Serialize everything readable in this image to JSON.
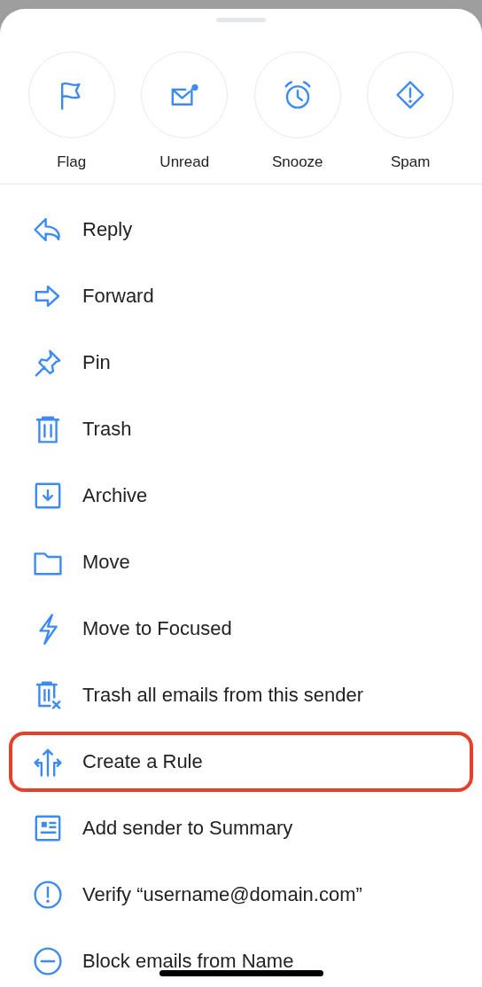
{
  "quick_actions": [
    {
      "label": "Flag",
      "kind": "flag"
    },
    {
      "label": "Unread",
      "kind": "unread"
    },
    {
      "label": "Snooze",
      "kind": "snooze"
    },
    {
      "label": "Spam",
      "kind": "spam"
    }
  ],
  "menu_items": [
    {
      "label": "Reply",
      "kind": "reply",
      "highlighted": false
    },
    {
      "label": "Forward",
      "kind": "forward",
      "highlighted": false
    },
    {
      "label": "Pin",
      "kind": "pin",
      "highlighted": false
    },
    {
      "label": "Trash",
      "kind": "trash",
      "highlighted": false
    },
    {
      "label": "Archive",
      "kind": "archive",
      "highlighted": false
    },
    {
      "label": "Move",
      "kind": "folder",
      "highlighted": false
    },
    {
      "label": "Move to Focused",
      "kind": "bolt",
      "highlighted": false
    },
    {
      "label": "Trash all emails from this sender",
      "kind": "trash-x",
      "highlighted": false
    },
    {
      "label": "Create a Rule",
      "kind": "rule",
      "highlighted": true
    },
    {
      "label": "Add sender to Summary",
      "kind": "summary",
      "highlighted": false
    },
    {
      "label": "Verify “username@domain.com”",
      "kind": "verify",
      "highlighted": false
    },
    {
      "label": "Block emails from Name",
      "kind": "block",
      "highlighted": false
    }
  ]
}
